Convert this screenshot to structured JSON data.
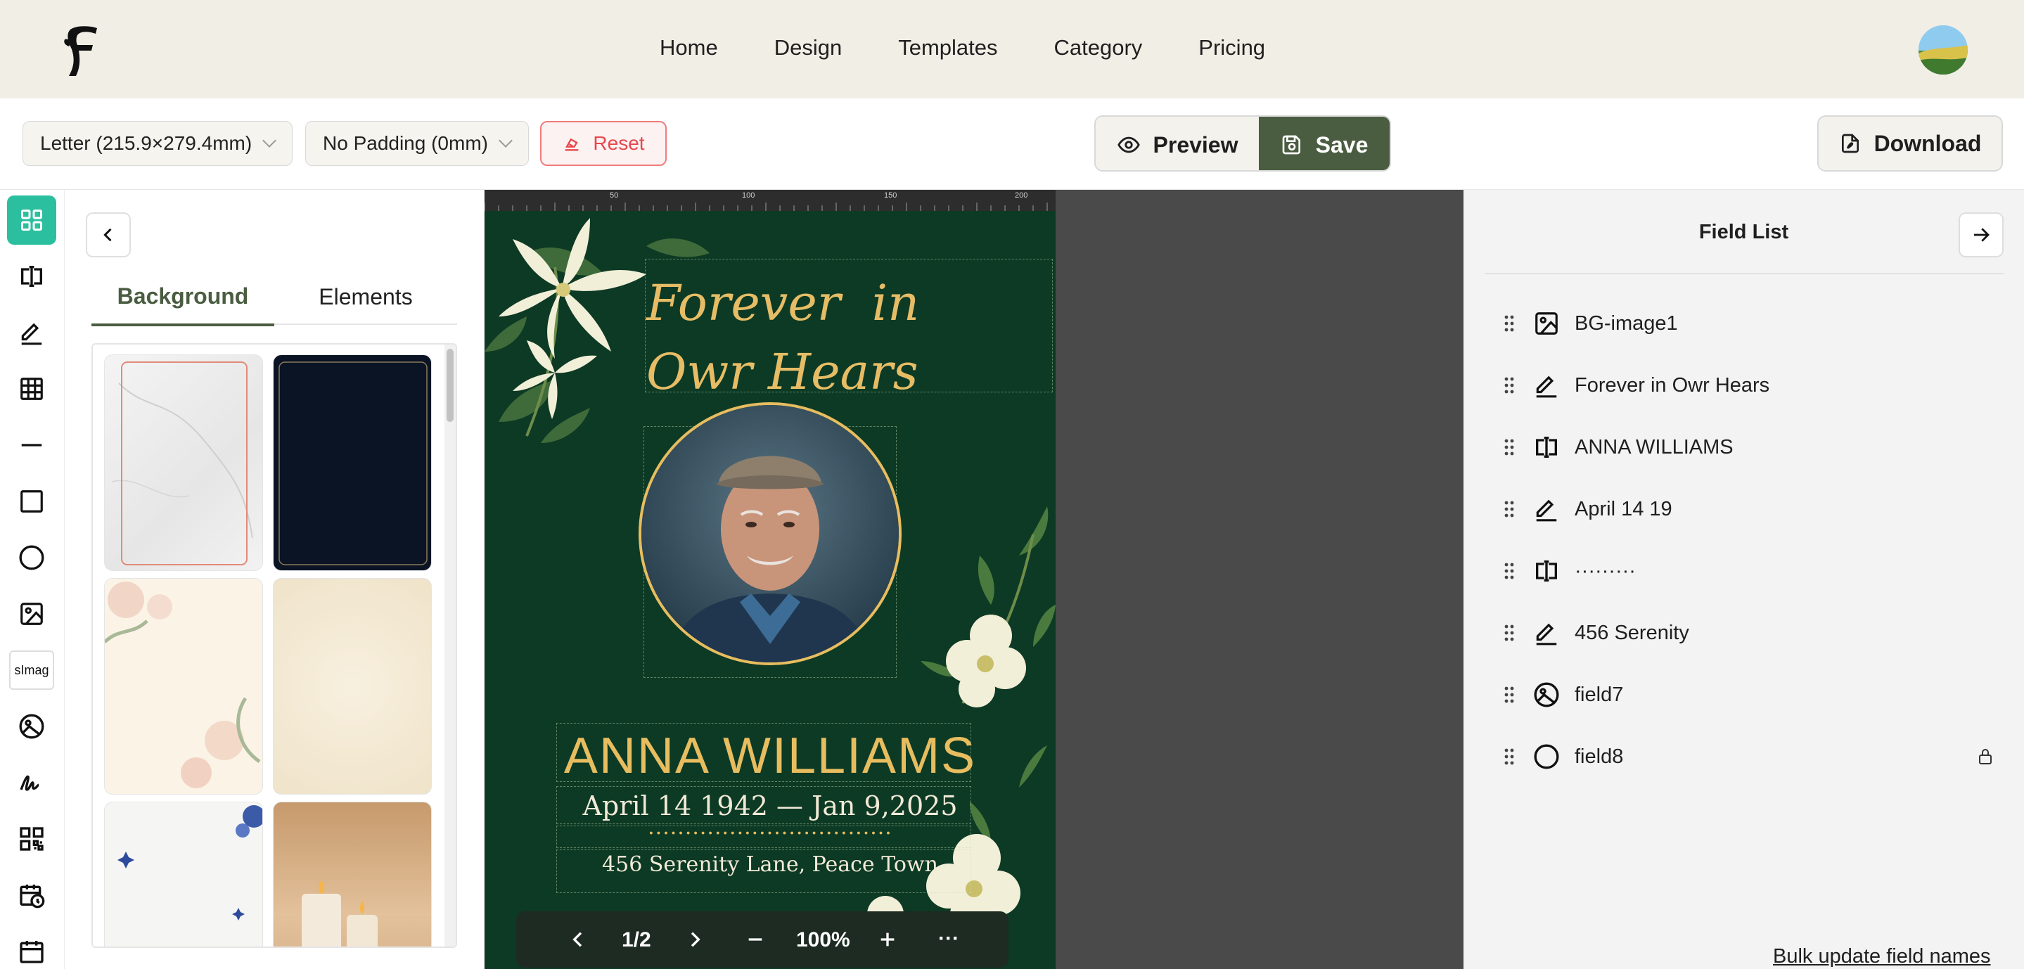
{
  "nav": {
    "links": [
      "Home",
      "Design",
      "Templates",
      "Category",
      "Pricing"
    ]
  },
  "toolbar": {
    "page_size": "Letter (215.9×279.4mm)",
    "padding": "No Padding (0mm)",
    "reset_label": "Reset",
    "preview_label": "Preview",
    "save_label": "Save",
    "download_label": "Download"
  },
  "rail": {
    "tools": [
      "grid-icon",
      "text-field-icon",
      "pen-icon",
      "table-icon",
      "line-icon",
      "rectangle-icon",
      "circle-icon",
      "image-icon",
      "simage-icon",
      "image-circle-icon",
      "signature-icon",
      "qr-code-icon",
      "date-time-icon",
      "calendar-icon"
    ],
    "simage_label": "sImag"
  },
  "left_panel": {
    "tabs": [
      "Background",
      "Elements"
    ],
    "active_tab": "Background"
  },
  "canvas": {
    "ruler_ticks": [
      "50",
      "100",
      "150",
      "200"
    ],
    "title_line1": "Forever  in",
    "title_line2": "Owr Hears",
    "name": "ANNA WILLIAMS",
    "dates": "April 14 1942 — Jan 9,2025",
    "dots": "·································",
    "address": "456 Serenity Lane, Peace Town",
    "page_indicator": "1/2",
    "zoom": "100%",
    "more": "···"
  },
  "field_list": {
    "title": "Field List",
    "fields": [
      {
        "label": "BG-image1",
        "icon": "image-icon"
      },
      {
        "label": "Forever in Owr Hears",
        "icon": "pen-icon"
      },
      {
        "label": "ANNA WILLIAMS",
        "icon": "text-field-icon"
      },
      {
        "label": "April 14 19",
        "icon": "pen-icon"
      },
      {
        "label": "·········",
        "icon": "text-field-icon"
      },
      {
        "label": "456 Serenity",
        "icon": "pen-icon"
      },
      {
        "label": "field7",
        "icon": "image-circle-icon"
      },
      {
        "label": "field8",
        "icon": "circle-icon",
        "locked": true
      }
    ],
    "bulk_update": "Bulk update field names"
  },
  "colors": {
    "brand_green": "#4a5d41",
    "accent_teal": "#2bbf9f",
    "card_green": "#0d3a24",
    "gold": "#e7bd60",
    "reset_red": "#e5484d"
  }
}
